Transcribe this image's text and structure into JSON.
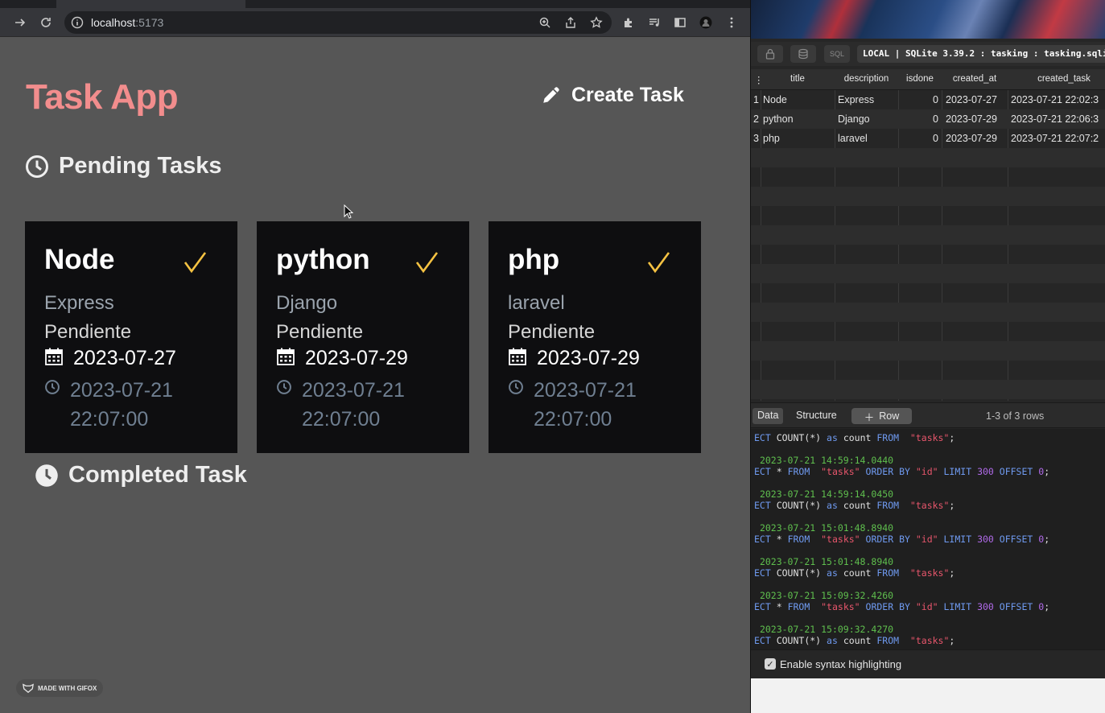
{
  "browser": {
    "url_host": "localhost",
    "url_port": ":5173"
  },
  "app": {
    "title": "Task App",
    "create_label": "Create Task",
    "pending_title": "Pending Tasks",
    "completed_title": "Completed Task",
    "tasks": [
      {
        "title": "Node",
        "description": "Express",
        "status": "Pendiente",
        "due": "2023-07-27",
        "created_date": "2023-07-21",
        "created_time": "22:07:00"
      },
      {
        "title": "python",
        "description": "Django",
        "status": "Pendiente",
        "due": "2023-07-29",
        "created_date": "2023-07-21",
        "created_time": "22:07:00"
      },
      {
        "title": "php",
        "description": "laravel",
        "status": "Pendiente",
        "due": "2023-07-29",
        "created_date": "2023-07-21",
        "created_time": "22:07:00"
      }
    ],
    "badge": "MADE WITH GIFOX"
  },
  "db": {
    "sql_button": "SQL",
    "status": "LOCAL | SQLite 3.39.2 : tasking : tasking.sqlite",
    "columns": [
      "title",
      "description",
      "isdone",
      "created_at",
      "created_task"
    ],
    "rows": [
      {
        "id": "1",
        "title": "Node",
        "description": "Express",
        "isdone": "0",
        "created_at": "2023-07-27",
        "created_task": "2023-07-21 22:02:3"
      },
      {
        "id": "2",
        "title": "python",
        "description": "Django",
        "isdone": "0",
        "created_at": "2023-07-29",
        "created_task": "2023-07-21 22:06:3"
      },
      {
        "id": "3",
        "title": "php",
        "description": "laravel",
        "isdone": "0",
        "created_at": "2023-07-29",
        "created_task": "2023-07-21 22:07:2"
      }
    ],
    "tabs": [
      "Data",
      "Structure"
    ],
    "row_button": "Row",
    "rows_count": "1-3 of 3 rows",
    "log": {
      "first_line": {
        "kw1": "ECT",
        "rest": " COUNT(*) ",
        "kw2": "as",
        "rest2": " count ",
        "kw3": "FROM",
        "str": "  \"tasks\"",
        "end": ";"
      },
      "entries": [
        {
          "ts": "2023-07-21 14:59:14.0440",
          "type": "select"
        },
        {
          "ts": "2023-07-21 14:59:14.0450",
          "type": "count"
        },
        {
          "ts": "2023-07-21 15:01:48.8940",
          "type": "select"
        },
        {
          "ts": "2023-07-21 15:01:48.8940",
          "type": "count"
        },
        {
          "ts": "2023-07-21 15:09:32.4260",
          "type": "select"
        },
        {
          "ts": "2023-07-21 15:09:32.4270",
          "type": "count"
        }
      ]
    },
    "syntax_label": "Enable syntax highlighting"
  }
}
